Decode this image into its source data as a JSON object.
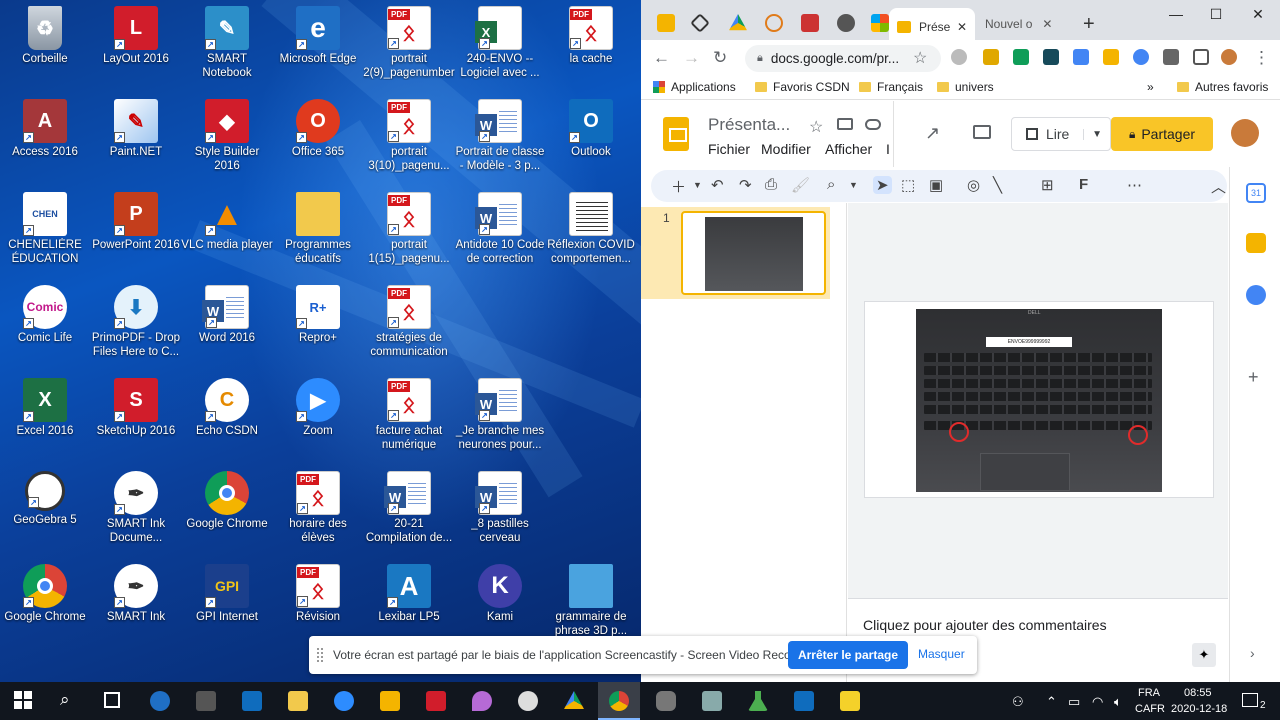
{
  "desktop": {
    "icons": [
      {
        "label": "Corbeille"
      },
      {
        "label": "LayOut 2016"
      },
      {
        "label": "SMART Notebook"
      },
      {
        "label": "Microsoft Edge"
      },
      {
        "label": "portrait 2(9)_pagenumber"
      },
      {
        "label": "240-ENVO -- Logiciel avec ..."
      },
      {
        "label": "la cache"
      },
      {
        "label": "Access 2016"
      },
      {
        "label": "Paint.NET"
      },
      {
        "label": "Style Builder 2016"
      },
      {
        "label": "Office 365"
      },
      {
        "label": "portrait 3(10)_pagenu..."
      },
      {
        "label": "Portrait de classe - Modèle - 3 p..."
      },
      {
        "label": "Outlook"
      },
      {
        "label": "CHENELIÈRE ÉDUCATION"
      },
      {
        "label": "PowerPoint 2016"
      },
      {
        "label": "VLC media player"
      },
      {
        "label": "Programmes éducatifs"
      },
      {
        "label": "portrait 1(15)_pagenu..."
      },
      {
        "label": "Antidote 10 Code de correction"
      },
      {
        "label": "Réflexion COVID comportemen..."
      },
      {
        "label": "Comic Life"
      },
      {
        "label": "PrimoPDF - Drop Files Here to C..."
      },
      {
        "label": "Word 2016"
      },
      {
        "label": "Repro+"
      },
      {
        "label": "stratégies de communication"
      },
      {
        "label": "Excel 2016"
      },
      {
        "label": "SketchUp 2016"
      },
      {
        "label": "Echo CSDN"
      },
      {
        "label": "Zoom"
      },
      {
        "label": "facture achat numérique"
      },
      {
        "label": "_Je branche mes neurones pour..."
      },
      {
        "label": "GeoGebra 5"
      },
      {
        "label": "SMART Ink Docume..."
      },
      {
        "label": "Google Chrome"
      },
      {
        "label": "horaire des élèves"
      },
      {
        "label": "20-21 Compilation de..."
      },
      {
        "label": "_8 pastilles cerveau"
      },
      {
        "label": "Google Chrome"
      },
      {
        "label": "SMART Ink"
      },
      {
        "label": "GPI Internet"
      },
      {
        "label": "Révision"
      },
      {
        "label": "Lexibar LP5"
      },
      {
        "label": "Kami"
      },
      {
        "label": "grammaire de phrase 3D p..."
      }
    ]
  },
  "chrome": {
    "tabs": {
      "active_title": "Prése",
      "next_title": "Nouvel o",
      "new_tab": "+"
    },
    "window": {
      "minimize": "—",
      "maximize": "☐",
      "close": "✕"
    },
    "url": "docs.google.com/pr...",
    "bookmarks": {
      "apps": "Applications",
      "items": [
        "Favoris CSDN",
        "Français",
        "univers"
      ],
      "more": "»",
      "other": "Autres favoris"
    }
  },
  "slides": {
    "title": "Présenta...",
    "menus": [
      "Fichier",
      "Modifier",
      "Afficher",
      "I"
    ],
    "present_label": "Lire",
    "share_label": "Partager",
    "slide_number": "1",
    "laptop_label": "ENVOE999999992",
    "brand": "DELL",
    "notes_placeholder": "Cliquez pour ajouter des commentaires",
    "calendar_badge": "31"
  },
  "share_notice": {
    "text": "Votre écran est partagé par le biais de l'application Screencastify - Screen Video Recorder.",
    "stop_label": "Arrêter le partage",
    "hide_label": "Masquer"
  },
  "taskbar": {
    "lang": "FRA",
    "layout": "CAFR",
    "time": "08:55",
    "date": "2020-12-18",
    "notification_count": "2"
  },
  "colors": {
    "slides_yellow": "#f4b400",
    "share_blue": "#1a73e8",
    "share_btn_yellow": "#f9c527"
  }
}
